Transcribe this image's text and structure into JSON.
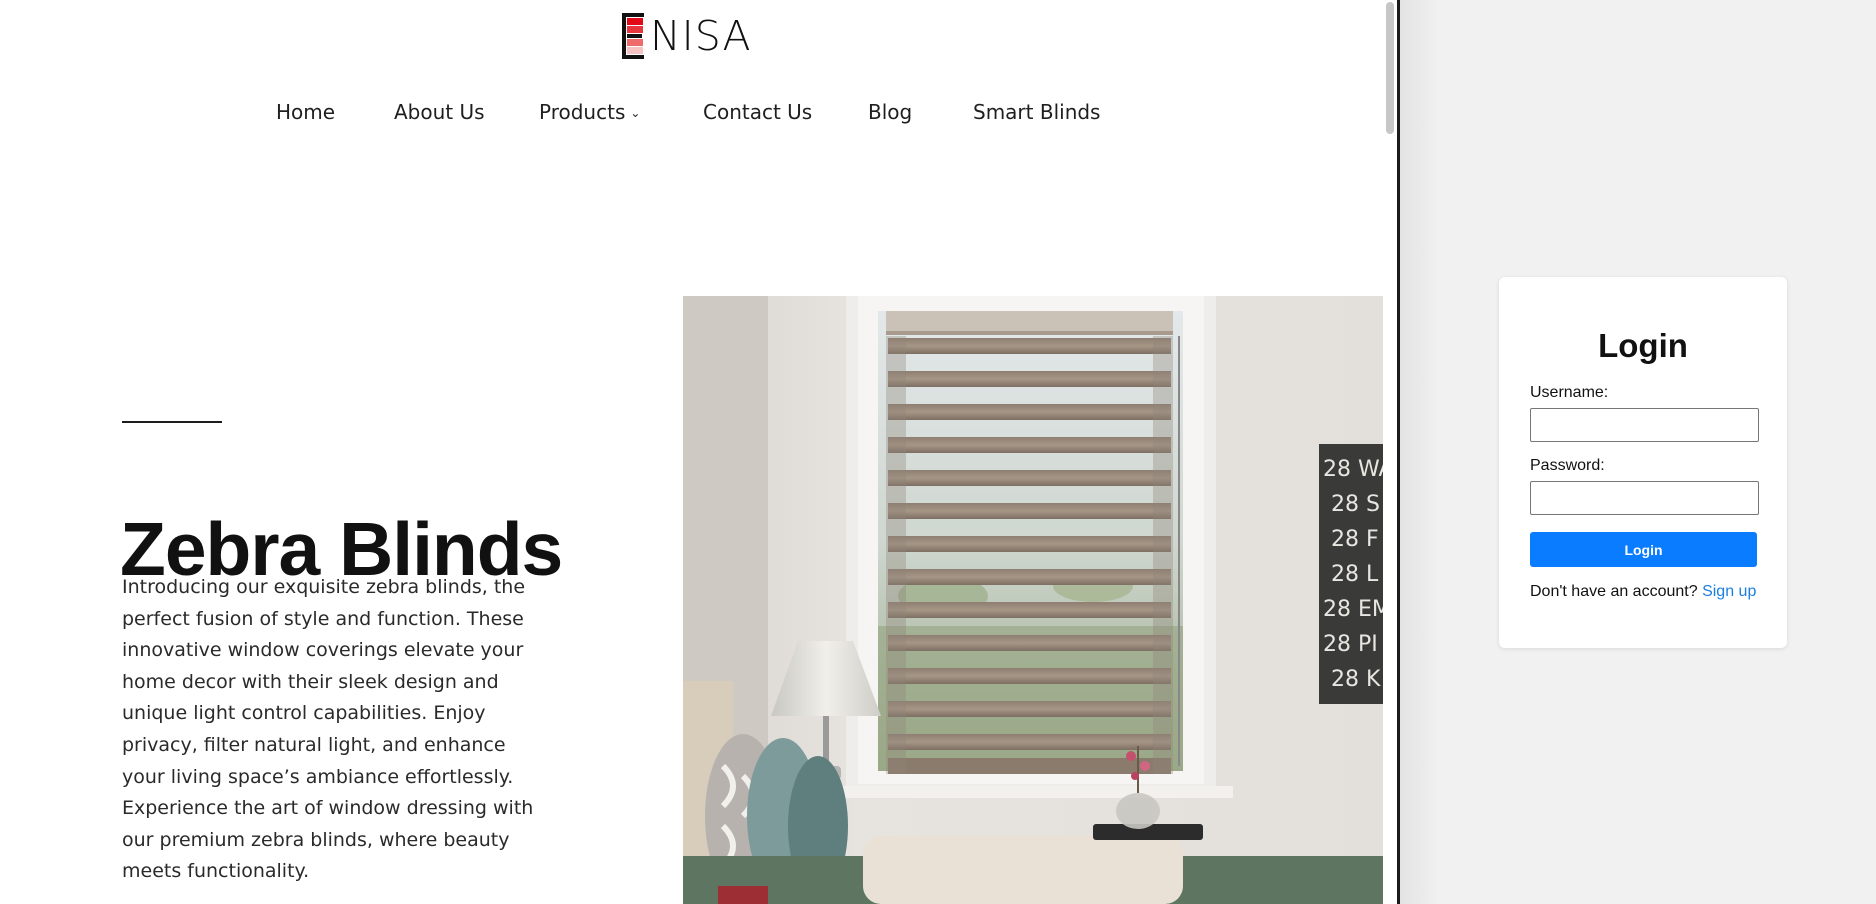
{
  "brand": {
    "logo_text": "NISA",
    "logo_letter": "E",
    "logo_colors": [
      "#e20a16",
      "#ef6a6a",
      "#f6c2c2"
    ]
  },
  "nav": {
    "items": [
      {
        "label": "Home"
      },
      {
        "label": "About Us"
      },
      {
        "label": "Products",
        "has_dropdown": true,
        "icon": "chevron-down-icon"
      },
      {
        "label": "Contact Us"
      },
      {
        "label": "Blog"
      },
      {
        "label": "Smart Blinds"
      }
    ]
  },
  "hero": {
    "title": "Zebra Blinds",
    "body": "Introducing our exquisite zebra blinds, the perfect fusion of style and function. These innovative window coverings elevate your home decor with their sleek design and unique light control capabilities. Enjoy privacy, filter natural light, and enhance your living space’s ambiance effortlessly. Experience the art of window dressing with our premium zebra blinds, where beauty meets functionality."
  },
  "photo": {
    "sign_lines": [
      "28 WA",
      "28 S",
      "28 F",
      "28 L",
      "28 EM",
      "28 PI",
      "28 K"
    ]
  },
  "login": {
    "title": "Login",
    "username_label": "Username:",
    "username_value": "",
    "password_label": "Password:",
    "password_value": "",
    "button_label": "Login",
    "signup_prompt": "Don't have an account?",
    "signup_link": "Sign up",
    "accent_color": "#0a7cff",
    "link_color": "#1b7fe0"
  }
}
